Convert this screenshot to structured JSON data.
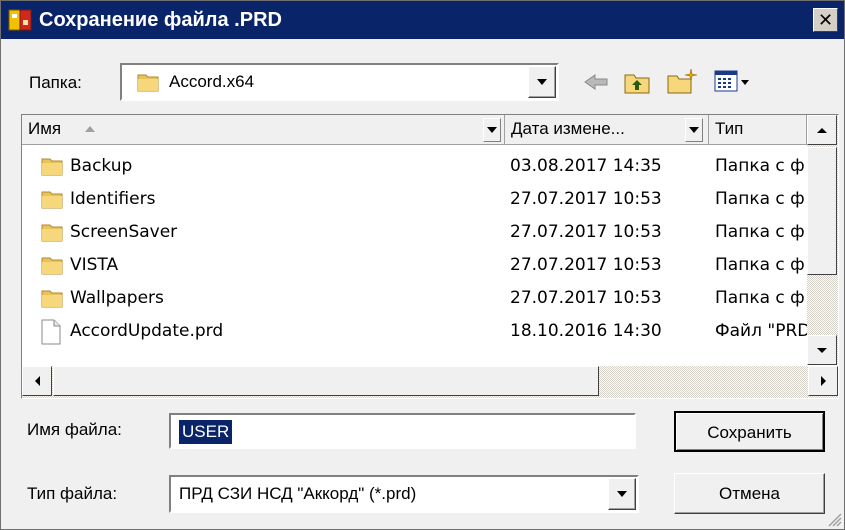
{
  "window": {
    "title": "Сохранение файла .PRD"
  },
  "folder": {
    "label": "Папка:",
    "value": "Accord.x64"
  },
  "toolbar": {
    "icons": [
      "back-arrow-icon",
      "up-folder-icon",
      "new-folder-icon",
      "view-menu-icon"
    ]
  },
  "filelist": {
    "columns": [
      {
        "label": "Имя"
      },
      {
        "label": "Дата измене..."
      },
      {
        "label": "Тип"
      }
    ],
    "rows": [
      {
        "icon": "folder-icon",
        "name": "Backup",
        "date": "03.08.2017 14:35",
        "type": "Папка с ф"
      },
      {
        "icon": "folder-icon",
        "name": "Identifiers",
        "date": "27.07.2017 10:53",
        "type": "Папка с ф"
      },
      {
        "icon": "folder-icon",
        "name": "ScreenSaver",
        "date": "27.07.2017 10:53",
        "type": "Папка с ф"
      },
      {
        "icon": "folder-icon",
        "name": "VISTA",
        "date": "27.07.2017 10:53",
        "type": "Папка с ф"
      },
      {
        "icon": "folder-icon",
        "name": "Wallpapers",
        "date": "27.07.2017 10:53",
        "type": "Папка с ф"
      },
      {
        "icon": "file-icon",
        "name": "AccordUpdate.prd",
        "date": "18.10.2016 14:30",
        "type": "Файл \"PRD\""
      }
    ]
  },
  "filename": {
    "label": "Имя файла:",
    "value": "USER"
  },
  "filetype": {
    "label": "Тип файла:",
    "value": "ПРД СЗИ НСД \"Аккорд\" (*.prd)"
  },
  "buttons": {
    "save": "Сохранить",
    "cancel": "Отмена"
  },
  "colors": {
    "titlebar": "#0a246a",
    "selection": "#0a246a",
    "face": "#f0f0f0"
  }
}
